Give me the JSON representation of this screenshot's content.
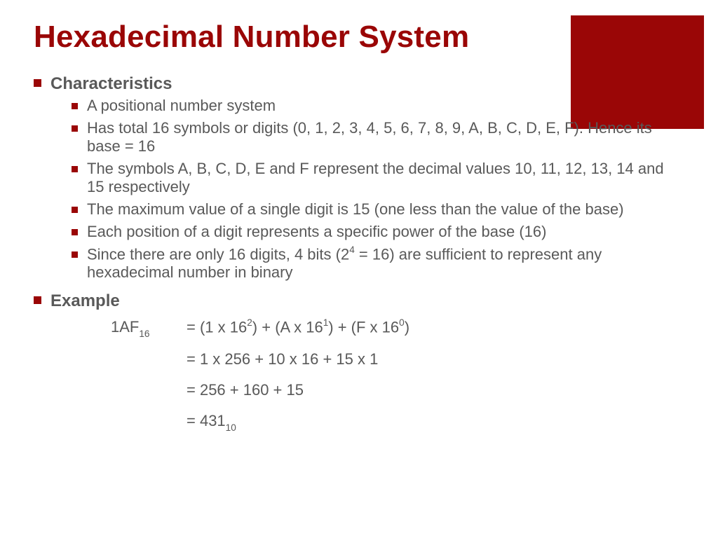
{
  "title": "Hexadecimal Number System",
  "sections": {
    "characteristics": {
      "heading": "Characteristics",
      "items": [
        "A positional number system",
        "Has total 16 symbols or digits (0, 1, 2, 3, 4, 5, 6, 7, 8, 9, A, B, C, D, E, F). Hence its base = 16",
        "The symbols A, B, C, D, E and F represent the decimal values 10, 11, 12, 13, 14 and 15 respectively",
        "The maximum value of a single digit is 15 (one less than the value of the base)",
        "Each position of a digit represents a specific power of the base (16)",
        "Since there are only 16 digits, 4 bits (2^4 = 16) are sufficient to represent any hexadecimal number in binary"
      ]
    },
    "example": {
      "heading": "Example",
      "lhs_value": "1AF",
      "lhs_base": "16",
      "lines": {
        "l1_a": "= (1 x 16",
        "l1_b": ") + (A x 16",
        "l1_c": ") + (F x 16",
        "l1_d": ")",
        "e2": "2",
        "e1": "1",
        "e0": "0",
        "l2": "= 1 x 256 + 10 x 16 + 15 x 1",
        "l3": "= 256 + 160 + 15",
        "l4_a": "= 431",
        "l4_base": "10"
      }
    }
  },
  "sup4": "4",
  "bits_text_a": "Since there are only 16 digits, 4 bits (2",
  "bits_text_b": " = 16) are sufficient to represent any hexadecimal number in binary"
}
